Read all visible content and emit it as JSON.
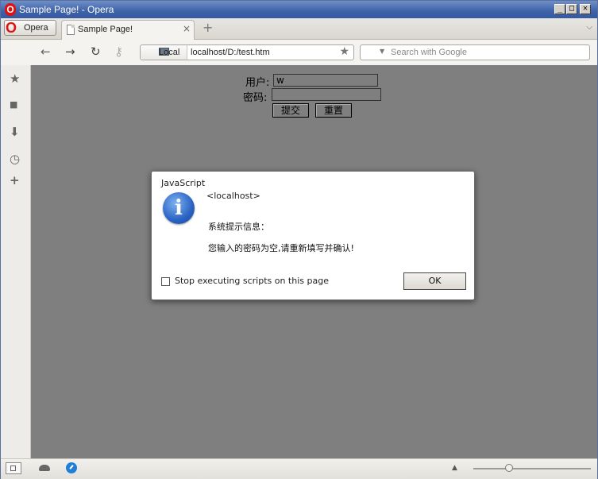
{
  "window": {
    "title": "Sample Page! - Opera",
    "controls": {
      "minimize": "_",
      "maximize": "□",
      "close": "✕"
    }
  },
  "tabs": {
    "menu_label": "Opera",
    "active_tab": "Sample Page!",
    "close": "×",
    "new_tab": "+",
    "tab_menu": "⌵"
  },
  "navigation": {
    "back": "←",
    "forward": "→",
    "reload": "↻",
    "key": "⚷",
    "security_label": "Local",
    "url": "localhost/D:/test.htm",
    "bookmark": "★",
    "search_placeholder": "Search with Google",
    "search_dropdown": "▼"
  },
  "sidebar": {
    "items": [
      {
        "name": "bookmarks-icon",
        "glyph": "★"
      },
      {
        "name": "notes-icon",
        "glyph": "■"
      },
      {
        "name": "downloads-icon",
        "glyph": "⬇"
      },
      {
        "name": "history-icon",
        "glyph": "◷"
      },
      {
        "name": "add-panel-icon",
        "glyph": "+"
      }
    ]
  },
  "page_form": {
    "username_label": "用户:",
    "username_value": "w",
    "password_label": "密码:",
    "password_value": "",
    "submit_label": "提交",
    "reset_label": "重置"
  },
  "dialog": {
    "title": "JavaScript",
    "icon_glyph": "i",
    "origin": "<localhost>",
    "message_line1": "系统提示信息：",
    "message_line2": "您输入的密码为空,请重新填写并确认!",
    "checkbox_label": "Stop executing scripts on this page",
    "checkbox_checked": false,
    "ok_label": "OK"
  },
  "statusbar": {
    "up_arrow": "▲",
    "zoom_fraction": 0.29
  },
  "colors": {
    "titlebar": "#3e62a8",
    "page_background": "#7f7f7f",
    "opera_red": "#dd1111",
    "info_blue": "#2a63c4"
  }
}
